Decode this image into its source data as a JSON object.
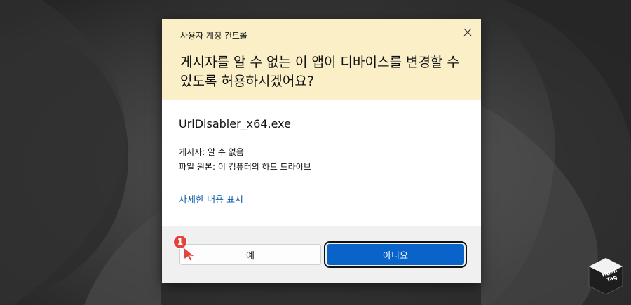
{
  "dialog": {
    "title": "사용자 계정 컨트롤",
    "question": "게시자를 알 수 없는 이 앱이 디바이스를 변경할 수 있도록 허용하시겠어요?",
    "program_name": "UrlDisabler_x64.exe",
    "publisher": "게시자: 알 수 없음",
    "origin": "파일 원본: 이 컴퓨터의 하드 드라이브",
    "details_link": "자세한 내용 표시",
    "yes_label": "예",
    "no_label": "아니요"
  },
  "annotation": {
    "step": "1"
  },
  "watermark": {
    "line1": "Hash",
    "line2": "Tag"
  },
  "colors": {
    "header_bg": "#fbefc7",
    "primary_button": "#0a63c8",
    "link": "#0b5aa6",
    "badge": "#e0443a"
  }
}
